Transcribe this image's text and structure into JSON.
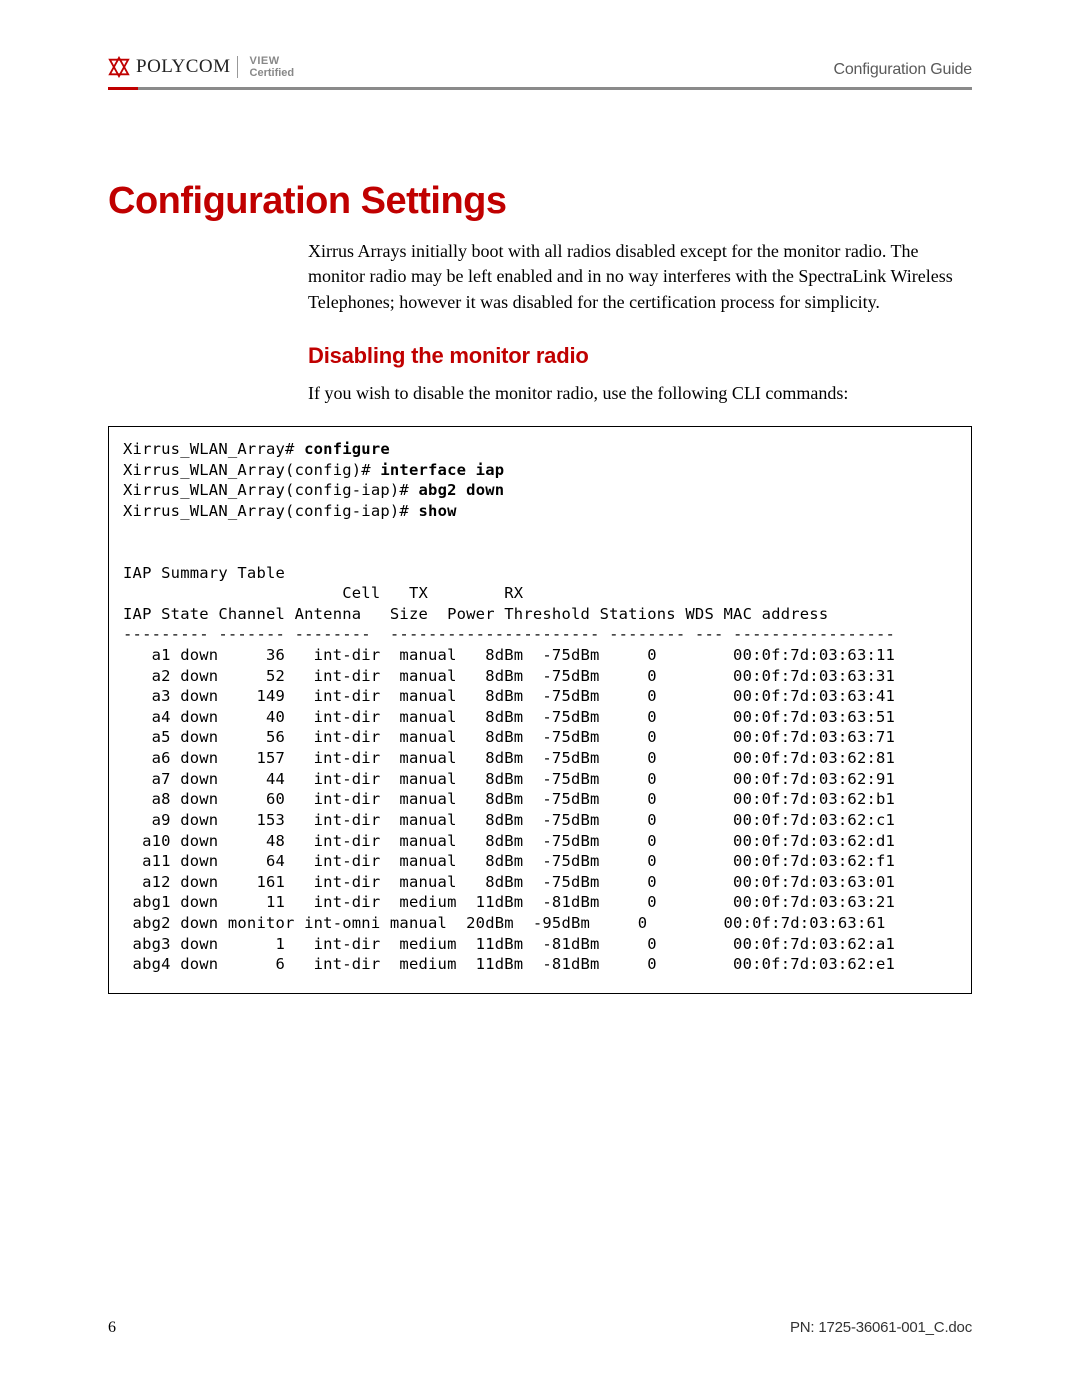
{
  "header": {
    "brand": "POLYCOM",
    "cert_line1": "VIEW",
    "cert_line2": "Certified",
    "guide": "Configuration Guide"
  },
  "title": "Configuration Settings",
  "intro_para": "Xirrus Arrays initially boot with all radios disabled except for the monitor radio. The monitor radio may be left enabled and in no way interferes with the SpectraLink Wireless Telephones; however it was disabled for the certification process for simplicity.",
  "subhead": "Disabling the monitor radio",
  "sub_para": "If you wish to disable the monitor radio, use the following CLI commands:",
  "cli": {
    "prompt1": "Xirrus_WLAN_Array# ",
    "cmd1": "configure",
    "prompt2": "Xirrus_WLAN_Array(config)# ",
    "cmd2": "interface iap",
    "prompt3": "Xirrus_WLAN_Array(config-iap)# ",
    "cmd3": "abg2 down",
    "prompt4": "Xirrus_WLAN_Array(config-iap)# ",
    "cmd4": "show",
    "summary_title": "IAP Summary Table",
    "hdr1": "                       Cell   TX        RX",
    "hdr2": "IAP State Channel Antenna   Size  Power Threshold Stations WDS MAC address",
    "sep": "--------- ------- --------  ---------------------- -------- --- -----------------",
    "rows": [
      "   a1 down     36   int-dir  manual   8dBm  -75dBm     0        00:0f:7d:03:63:11",
      "   a2 down     52   int-dir  manual   8dBm  -75dBm     0        00:0f:7d:03:63:31",
      "   a3 down    149   int-dir  manual   8dBm  -75dBm     0        00:0f:7d:03:63:41",
      "   a4 down     40   int-dir  manual   8dBm  -75dBm     0        00:0f:7d:03:63:51",
      "   a5 down     56   int-dir  manual   8dBm  -75dBm     0        00:0f:7d:03:63:71",
      "   a6 down    157   int-dir  manual   8dBm  -75dBm     0        00:0f:7d:03:62:81",
      "   a7 down     44   int-dir  manual   8dBm  -75dBm     0        00:0f:7d:03:62:91",
      "   a8 down     60   int-dir  manual   8dBm  -75dBm     0        00:0f:7d:03:62:b1",
      "   a9 down    153   int-dir  manual   8dBm  -75dBm     0        00:0f:7d:03:62:c1",
      "  a10 down     48   int-dir  manual   8dBm  -75dBm     0        00:0f:7d:03:62:d1",
      "  a11 down     64   int-dir  manual   8dBm  -75dBm     0        00:0f:7d:03:62:f1",
      "  a12 down    161   int-dir  manual   8dBm  -75dBm     0        00:0f:7d:03:63:01",
      " abg1 down     11   int-dir  medium  11dBm  -81dBm     0        00:0f:7d:03:63:21",
      " abg2 down monitor int-omni manual  20dBm  -95dBm     0        00:0f:7d:03:63:61",
      " abg3 down      1   int-dir  medium  11dBm  -81dBm     0        00:0f:7d:03:62:a1",
      " abg4 down      6   int-dir  medium  11dBm  -81dBm     0        00:0f:7d:03:62:e1"
    ]
  },
  "footer": {
    "page": "6",
    "pn": "PN: 1725-36061-001_C.doc"
  }
}
